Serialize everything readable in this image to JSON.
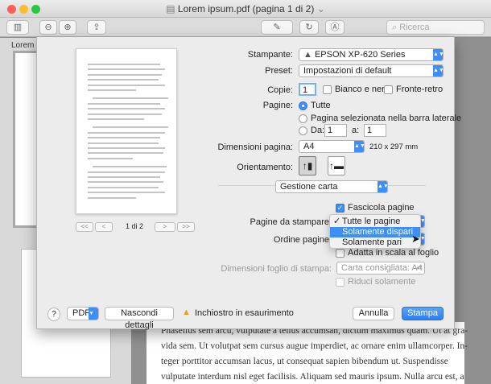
{
  "window": {
    "title": "Lorem ipsum.pdf (pagina 1 di 2)",
    "search_placeholder": "Ricerca"
  },
  "sidebar": {
    "label": "Lorem"
  },
  "document": {
    "lines": [
      "Phasellus sem arcu, vulputate a tellus accumsan, dictum maximus quam. Ut at gra-",
      "vida sem. Ut volutpat sem cursus augue imperdiet, ac ornare enim ullamcorper. In-",
      "teger porttitor accumsan lacus, ut consequat sapien bibendum ut. Suspendisse",
      "vulputate interdum nisl eget facilisis. Aliquam sed mauris ipsum. Nulla arcu est, a"
    ]
  },
  "preview": {
    "page_indicator": "1 di 2",
    "first": "<<",
    "prev": "<",
    "next": ">",
    "last": ">>"
  },
  "print": {
    "printer_label": "Stampante:",
    "printer_value": "EPSON XP-620 Series",
    "preset_label": "Preset:",
    "preset_value": "Impostazioni di default",
    "copies_label": "Copie:",
    "copies_value": "1",
    "bw_label": "Bianco e nero",
    "duplex_label": "Fronte-retro",
    "pages_label": "Pagine:",
    "pages_all": "Tutte",
    "pages_selected": "Pagina selezionata nella barra laterale",
    "pages_from": "Da:",
    "pages_from_value": "1",
    "pages_to": "a:",
    "pages_to_value": "1",
    "paper_label": "Dimensioni pagina:",
    "paper_value": "A4",
    "paper_dims": "210 x 297 mm",
    "orientation_label": "Orientamento:",
    "section_value": "Gestione carta",
    "collate_label": "Fascicola pagine",
    "pages_to_print_label": "Pagine da stampare",
    "page_order_label": "Ordine pagine",
    "scale_label": "Adatta in scala al foglio",
    "dest_size_label": "Dimensioni foglio di stampa:",
    "dest_size_value": "Carta consigliata: A4",
    "scale_down_label": "Riduci solamente",
    "menu_items": [
      "Tutte le pagine",
      "Solamente dispari",
      "Solamente pari"
    ],
    "menu_checked": "Tutte le pagine",
    "menu_highlighted": "Solamente dispari"
  },
  "footer": {
    "help": "?",
    "pdf": "PDF",
    "hide_details": "Nascondi dettagli",
    "ink_warning": "Inchiostro in esaurimento",
    "cancel": "Annulla",
    "print": "Stampa"
  },
  "colors": {
    "accent": "#3e8ef7"
  }
}
